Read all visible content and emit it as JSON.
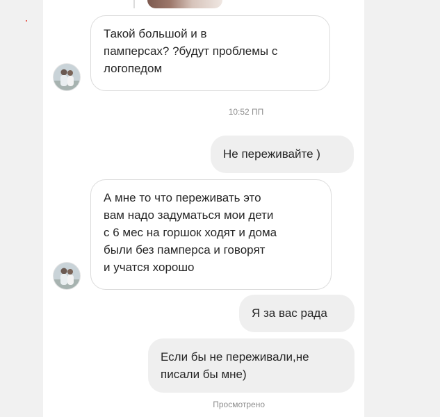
{
  "thread": {
    "timestamp": "10:52 ПП",
    "seen_label": "Просмотрено",
    "messages": [
      {
        "from": "them",
        "text": "Такой большой и в\nпамперсах? ?будут проблемы с\nлогопедом"
      },
      {
        "from": "me",
        "text": "Не переживайте )"
      },
      {
        "from": "them",
        "text": "А мне то что переживать это\nвам надо задуматься мои дети\nс 6 мес на горшок ходят и дома\nбыли без памперса и   говорят\nи учатся хорошо"
      },
      {
        "from": "me",
        "text": "Я за вас рада"
      },
      {
        "from": "me",
        "text": "Если бы не переживали,не\nписали бы мне)"
      }
    ]
  },
  "colors": {
    "background": "#f1f1f1",
    "panel": "#ffffff",
    "incoming_border": "#dbdbdb",
    "outgoing_bubble": "#efefef",
    "meta_text": "#8e8e8e"
  },
  "icons": {
    "contact_avatar": "avatar-photo"
  }
}
